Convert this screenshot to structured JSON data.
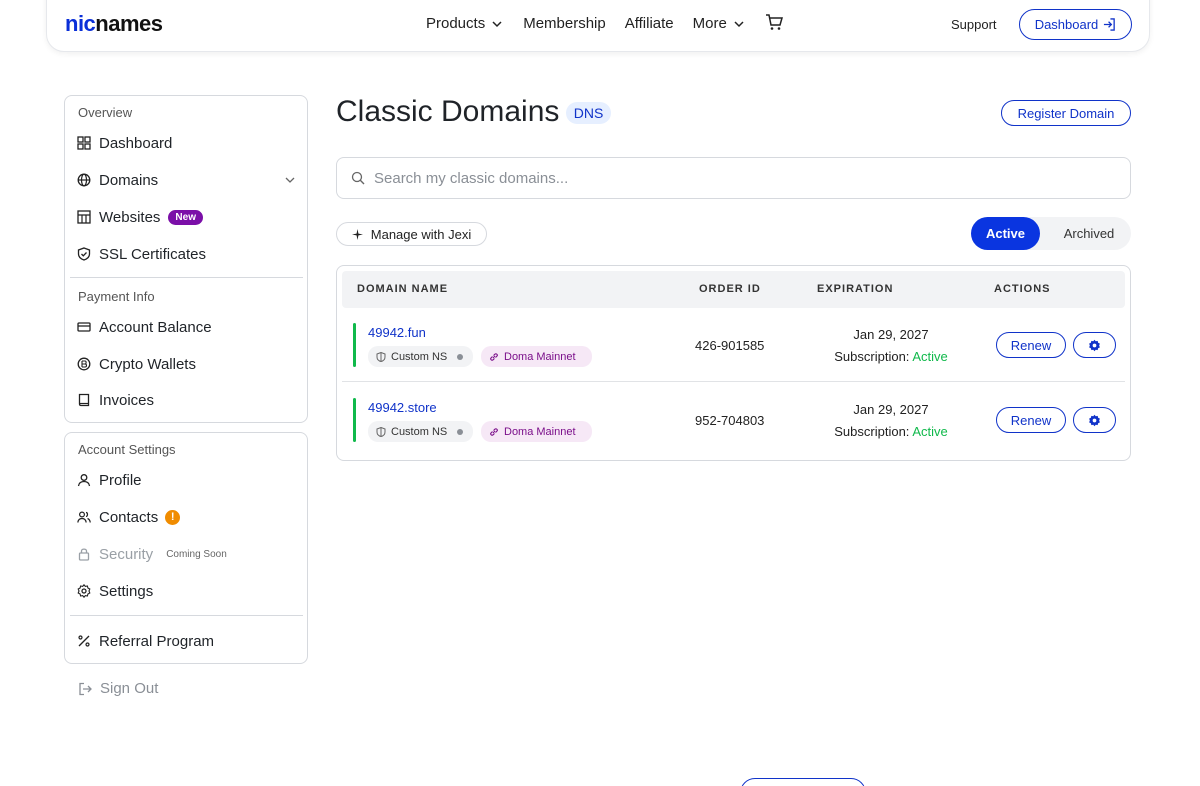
{
  "header": {
    "logo_mark": "nic",
    "logo_text": "names",
    "nav": [
      {
        "label": "Products",
        "has_dropdown": true
      },
      {
        "label": "Membership",
        "has_dropdown": false
      },
      {
        "label": "Affiliate",
        "has_dropdown": false
      },
      {
        "label": "More",
        "has_dropdown": true
      }
    ],
    "support_label": "Support",
    "dashboard_label": "Dashboard"
  },
  "sidebar": {
    "overview_label": "Overview",
    "overview_items": [
      {
        "label": "Dashboard",
        "icon": "grid-icon"
      },
      {
        "label": "Domains",
        "icon": "globe-icon"
      },
      {
        "label": "Websites",
        "icon": "layout-icon",
        "badge": "New"
      },
      {
        "label": "SSL Certificates",
        "icon": "shield-check-icon"
      }
    ],
    "payment_label": "Payment Info",
    "payment_items": [
      {
        "label": "Account Balance",
        "icon": "card-icon"
      },
      {
        "label": "Crypto Wallets",
        "icon": "coin-icon"
      },
      {
        "label": "Invoices",
        "icon": "book-icon"
      }
    ],
    "account_label": "Account Settings",
    "account_items": [
      {
        "label": "Profile",
        "icon": "user-icon"
      },
      {
        "label": "Contacts",
        "icon": "contacts-icon",
        "warning": "!"
      },
      {
        "label": "Security",
        "icon": "lock-icon",
        "tag": "Coming Soon"
      },
      {
        "label": "Settings",
        "icon": "gear-icon"
      }
    ],
    "referral_label": "Referral Program",
    "signout_label": "Sign Out"
  },
  "main": {
    "title": "Classic Domains",
    "dns_badge": "DNS",
    "register_label": "Register Domain",
    "search_placeholder": "Search my classic domains...",
    "jexi_label": "Manage with Jexi",
    "filter_active": "Active",
    "filter_archived": "Archived",
    "table": {
      "headers": [
        "DOMAIN NAME",
        "ORDER ID",
        "EXPIRATION",
        "ACTIONS"
      ],
      "rows": [
        {
          "domain": "49942.fun",
          "ns_label": "Custom NS",
          "network_label": "Doma Mainnet",
          "order_id": "426-901585",
          "expiration_date": "Jan 29, 2027",
          "subscription_prefix": "Subscription:",
          "subscription_status": "Active",
          "renew_label": "Renew"
        },
        {
          "domain": "49942.store",
          "ns_label": "Custom NS",
          "network_label": "Doma Mainnet",
          "order_id": "952-704803",
          "expiration_date": "Jan 29, 2027",
          "subscription_prefix": "Subscription:",
          "subscription_status": "Active",
          "renew_label": "Renew"
        }
      ]
    }
  },
  "colors": {
    "brand_blue": "#1033c9",
    "active_green": "#10b94b",
    "new_badge_purple": "#7b0fa8",
    "warning_orange": "#f08c00"
  }
}
